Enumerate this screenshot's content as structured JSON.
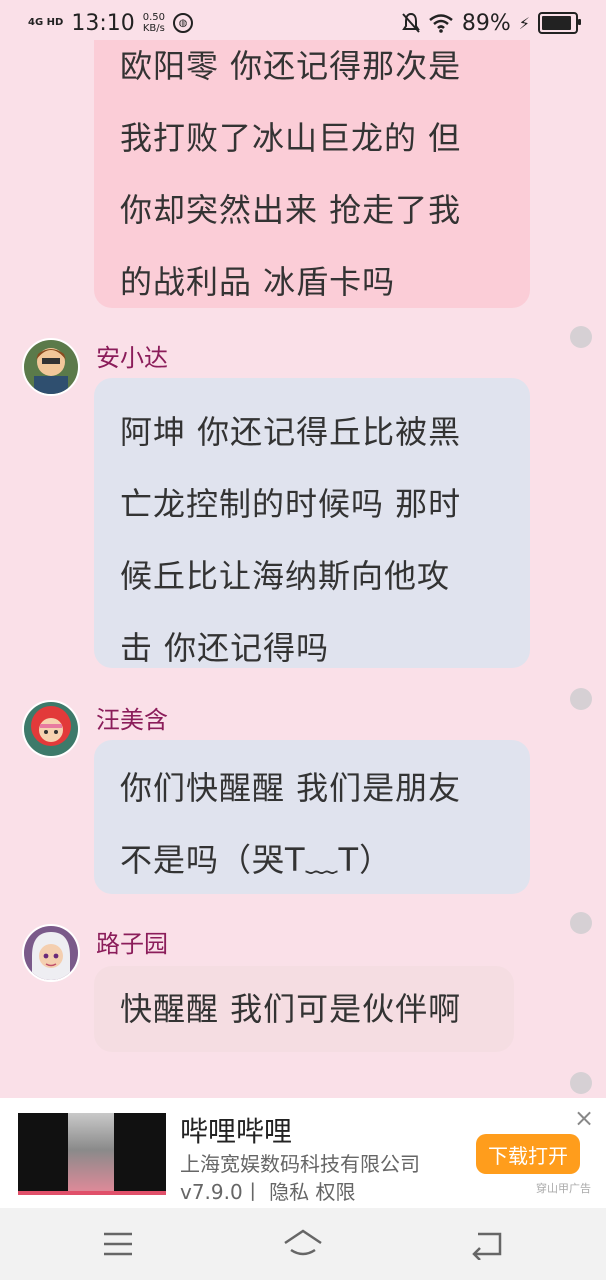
{
  "status": {
    "network": "4G HD",
    "time": "13:10",
    "speed_value": "0.50",
    "speed_unit": "KB/s",
    "battery": "89%"
  },
  "messages": [
    {
      "sender": "",
      "text_lines": [
        "欧阳零 你还记得那次是",
        "我打败了冰山巨龙的 但",
        "你却突然出来 抢走了我",
        "的战利品 冰盾卡吗"
      ]
    },
    {
      "sender": "安小达",
      "text_lines": [
        "阿坤 你还记得丘比被黑",
        "亡龙控制的时候吗 那时",
        "候丘比让海纳斯向他攻",
        "击 你还记得吗"
      ]
    },
    {
      "sender": "汪美含",
      "text_lines": [
        "你们快醒醒 我们是朋友",
        "不是吗（哭T﹏T）"
      ]
    },
    {
      "sender": "路子园",
      "text_lines": [
        "快醒醒 我们可是伙伴啊"
      ]
    }
  ],
  "ad": {
    "title": "哔哩哔哩",
    "company": "上海宽娱数码科技有限公司",
    "meta": "v7.9.0丨 隐私  权限",
    "button": "下载打开",
    "tag": "穿山甲广告",
    "close": "×"
  },
  "colors": {
    "background": "#fae0e8",
    "name": "#8b1d5a",
    "button": "#ff9d1c"
  }
}
